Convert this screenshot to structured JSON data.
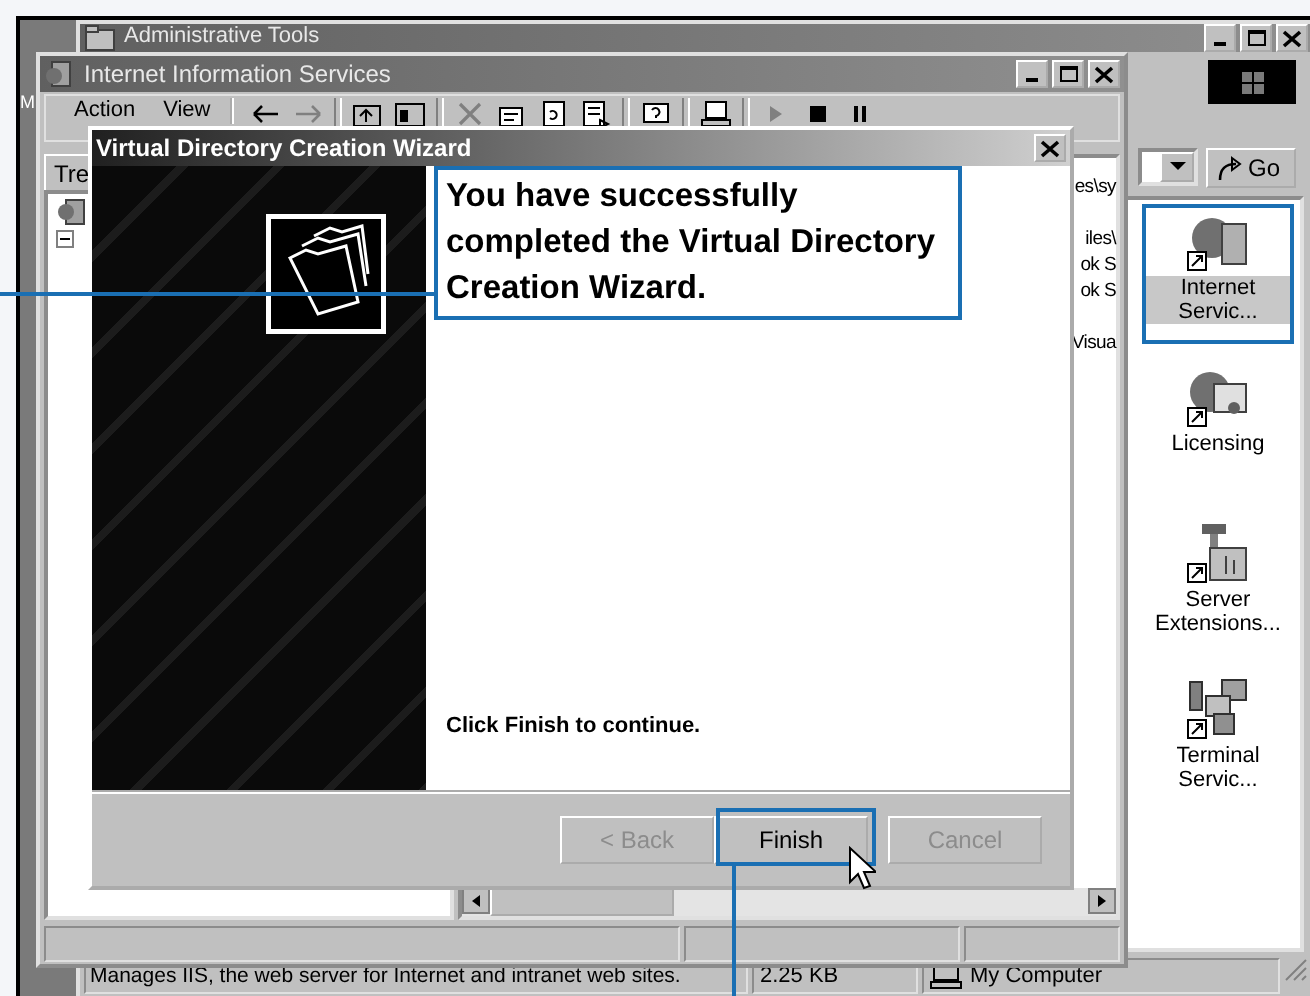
{
  "desktop": {
    "label": "M"
  },
  "admin_window": {
    "title": "Administrative Tools",
    "go_button": "Go",
    "icons": [
      {
        "label": "Internet Servic...",
        "selected": true,
        "kind": "iis"
      },
      {
        "label": "Licensing",
        "selected": false,
        "kind": "licensing"
      },
      {
        "label": "Server Extensions...",
        "selected": false,
        "kind": "server"
      },
      {
        "label": "Terminal Servic...",
        "selected": false,
        "kind": "terminal"
      }
    ],
    "status_bar": [
      "Manages IIS, the web server for Internet and intranet web sites.",
      "2.25 KB",
      "My Computer"
    ]
  },
  "iis_window": {
    "title": "Internet Information Services",
    "menu": [
      "Action",
      "View"
    ],
    "tab": "Tre",
    "list_fragments": [
      "es\\sy",
      "iles\\",
      "ok S",
      "ok S",
      "Visua"
    ]
  },
  "wizard": {
    "title": "Virtual Directory Creation Wizard",
    "heading": "You have successfully completed the Virtual Directory Creation Wizard.",
    "instruction": "Click Finish to continue.",
    "buttons": [
      {
        "label": "< Back",
        "disabled": true
      },
      {
        "label": "Finish",
        "disabled": false
      },
      {
        "label": "Cancel",
        "disabled": true
      }
    ]
  }
}
